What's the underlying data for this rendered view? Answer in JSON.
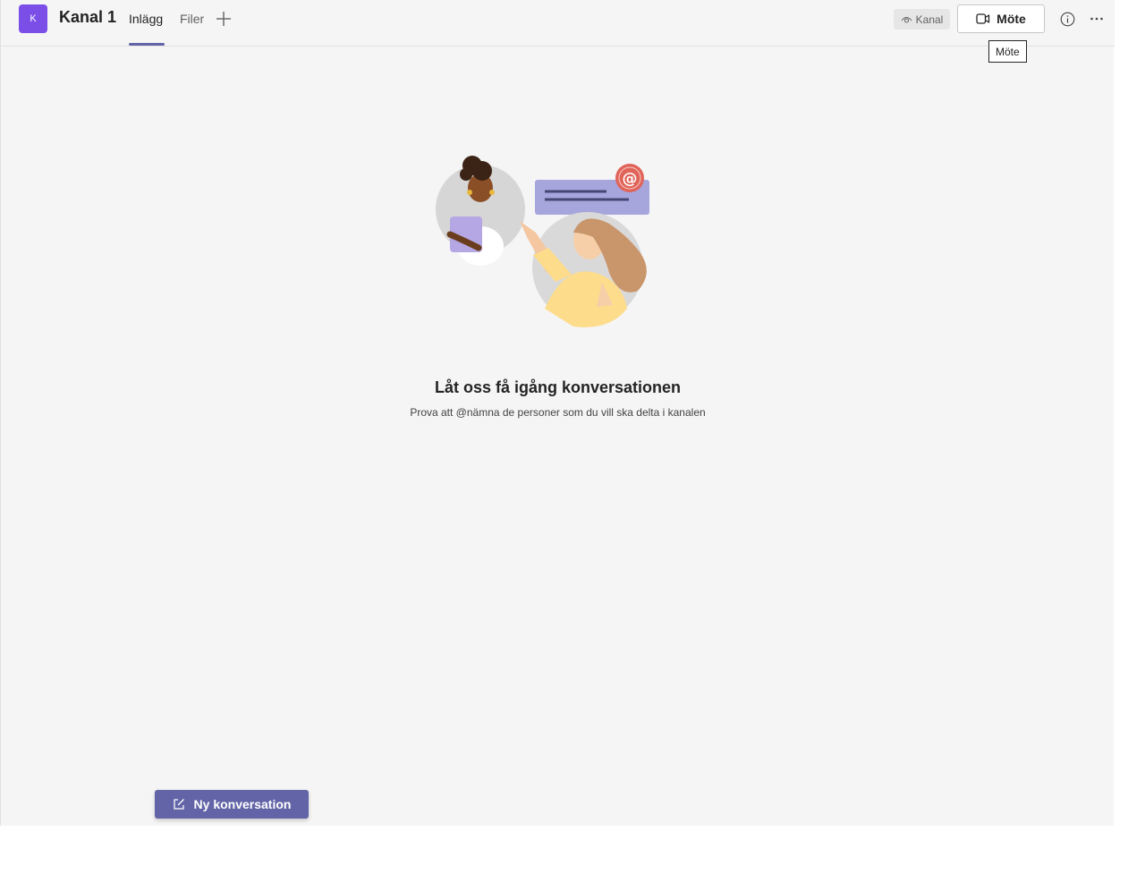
{
  "header": {
    "team_initial": "K",
    "channel_title": "Kanal 1",
    "tabs": [
      {
        "label": "Inlägg",
        "active": true
      },
      {
        "label": "Filer",
        "active": false
      }
    ],
    "add_tab_icon": "plus-icon",
    "channel_badge": {
      "label": "Kanal",
      "icon": "eye-icon"
    },
    "meet_button": {
      "label": "Möte",
      "icon": "video-camera-icon"
    },
    "tooltip": "Möte",
    "info_icon": "info-icon",
    "more_icon": "more-options-icon"
  },
  "main": {
    "empty_title": "Låt oss få igång konversationen",
    "empty_subtitle": "Prova att @nämna de personer som du vill ska delta i kanalen"
  },
  "footer": {
    "new_conversation_label": "Ny konversation",
    "new_conversation_icon": "compose-icon"
  },
  "colors": {
    "brand": "#6264a7",
    "team_avatar": "#7b4ee8",
    "mention_badge": "#e0645a"
  }
}
